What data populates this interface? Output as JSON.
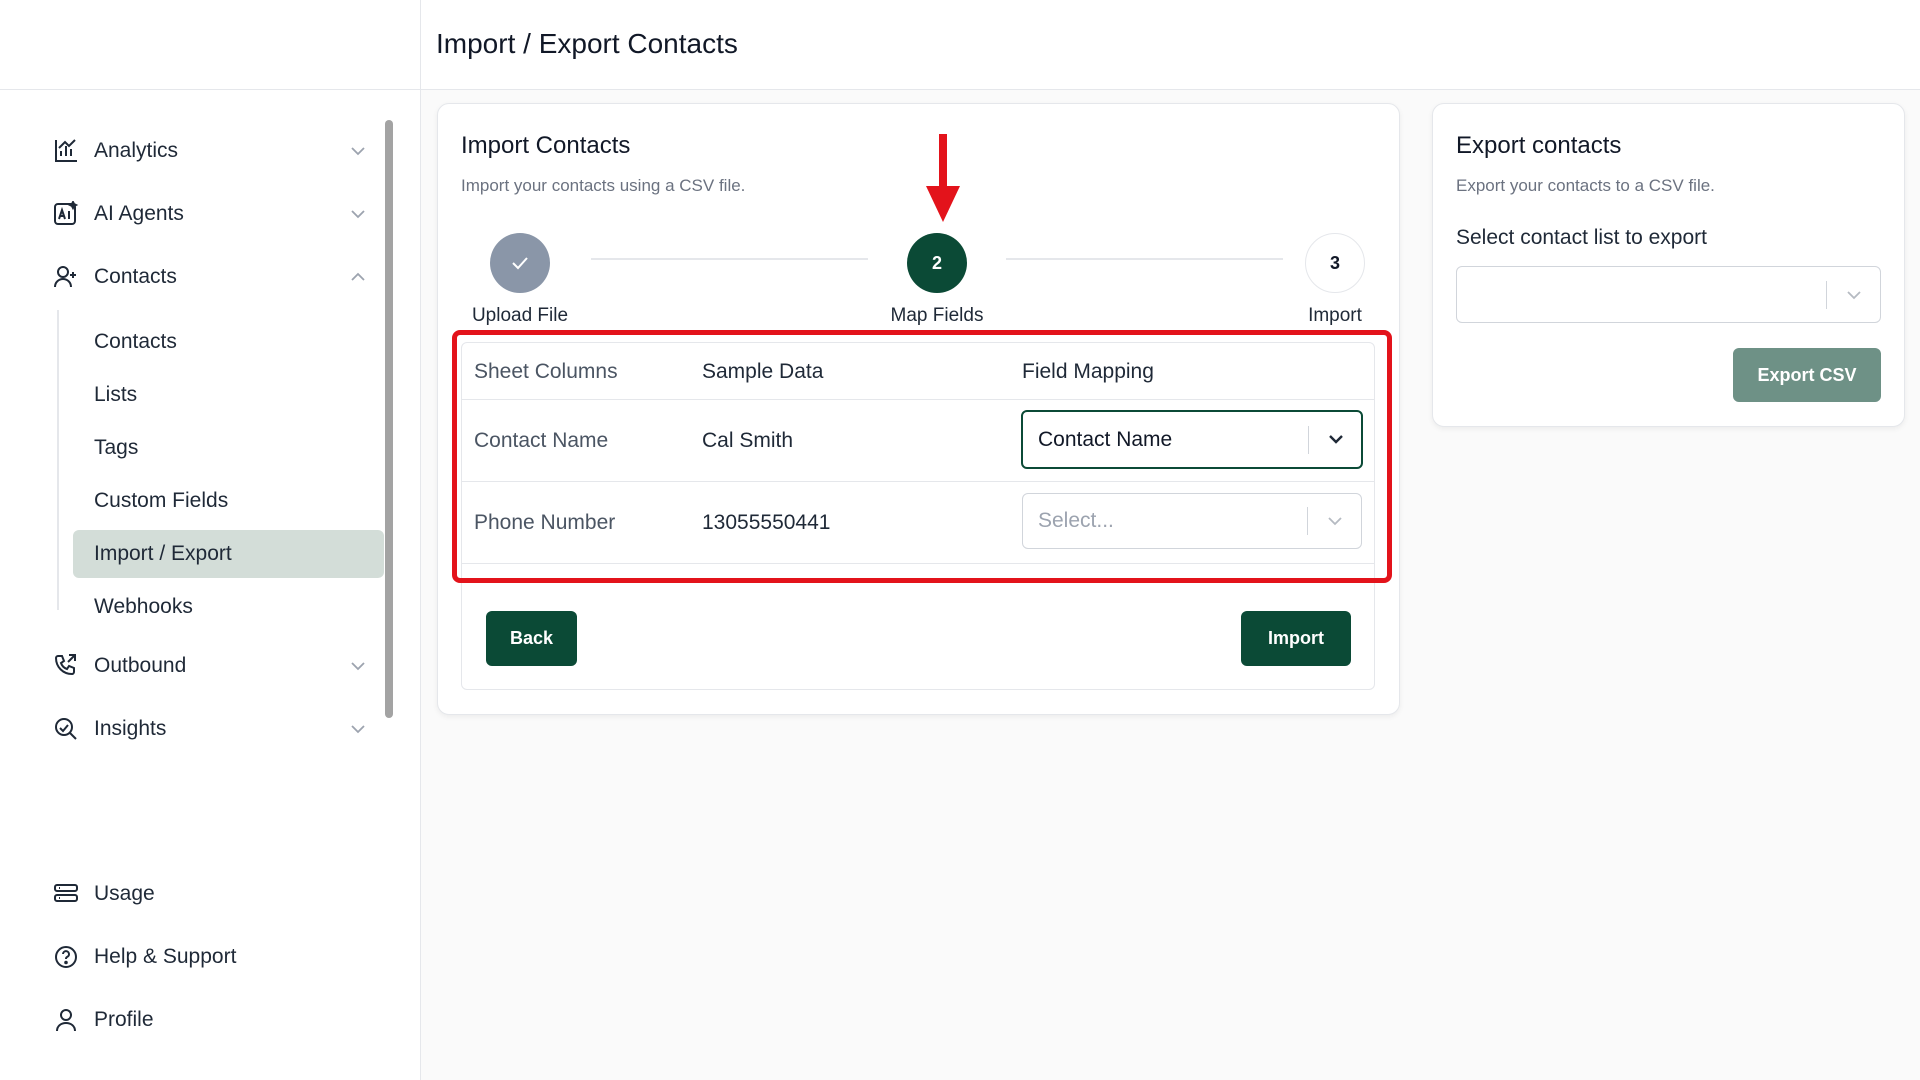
{
  "page": {
    "title": "Import / Export Contacts"
  },
  "sidebar": {
    "items": [
      {
        "label": "Analytics",
        "icon": "analytics-icon",
        "expandable": true,
        "expanded": false
      },
      {
        "label": "AI Agents",
        "icon": "ai-agents-icon",
        "expandable": true,
        "expanded": false
      },
      {
        "label": "Contacts",
        "icon": "contacts-icon",
        "expandable": true,
        "expanded": true
      },
      {
        "label": "Outbound",
        "icon": "outbound-icon",
        "expandable": true,
        "expanded": false
      },
      {
        "label": "Insights",
        "icon": "insights-icon",
        "expandable": true,
        "expanded": false
      }
    ],
    "contacts_sub": [
      "Contacts",
      "Lists",
      "Tags",
      "Custom Fields",
      "Import / Export",
      "Webhooks"
    ],
    "active_sub": "Import / Export",
    "bottom": [
      {
        "label": "Usage",
        "icon": "usage-icon"
      },
      {
        "label": "Help & Support",
        "icon": "help-icon"
      },
      {
        "label": "Profile",
        "icon": "profile-icon"
      }
    ]
  },
  "import_card": {
    "title": "Import Contacts",
    "subtitle": "Import your contacts using a CSV file.",
    "steps": [
      {
        "number": "1",
        "label": "Upload File",
        "state": "completed"
      },
      {
        "number": "2",
        "label": "Map Fields",
        "state": "current"
      },
      {
        "number": "3",
        "label": "Import",
        "state": "upcoming"
      }
    ],
    "table": {
      "headers": [
        "Sheet Columns",
        "Sample Data",
        "Field Mapping"
      ],
      "rows": [
        {
          "column": "Contact Name",
          "sample": "Cal Smith",
          "mapping": "Contact Name",
          "mapping_is_placeholder": false
        },
        {
          "column": "Phone Number",
          "sample": "13055550441",
          "mapping": "Select...",
          "mapping_is_placeholder": true
        }
      ]
    },
    "back_label": "Back",
    "import_label": "Import"
  },
  "export_card": {
    "title": "Export contacts",
    "subtitle": "Export your contacts to a CSV file.",
    "select_label": "Select contact list to export",
    "select_value": "",
    "button_label": "Export CSV"
  },
  "colors": {
    "primary": "#0b4a36",
    "primary_muted": "#6e9186",
    "completed_step": "#8a96a8",
    "active_nav_bg": "#d3ddd8",
    "annotation_red": "#e3131b"
  }
}
